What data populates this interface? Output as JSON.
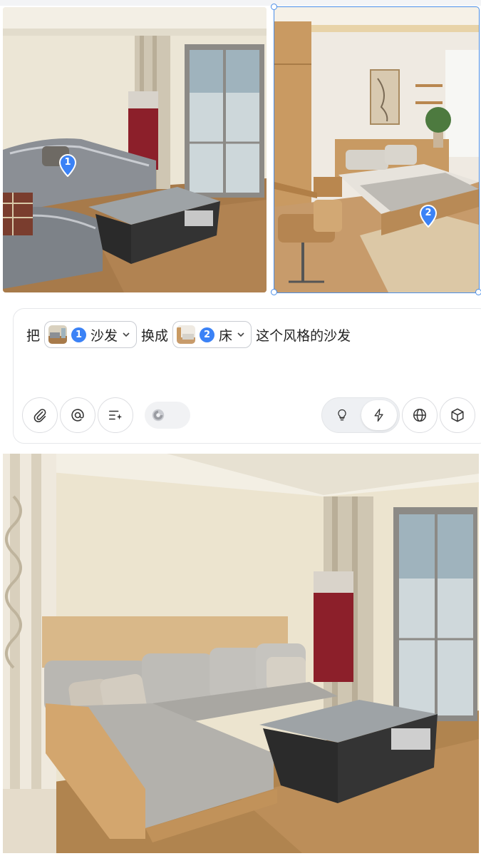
{
  "prompt": {
    "prefix": "把",
    "chip1": {
      "number": "1",
      "label": "沙发"
    },
    "middle": "换成",
    "chip2": {
      "number": "2",
      "label": "床"
    },
    "suffix": "这个风格的沙发"
  },
  "pins": {
    "photo1": "1",
    "photo2": "2"
  },
  "toolbar": {
    "left_icons": [
      "paperclip-icon",
      "at-icon",
      "sparkle-list-icon",
      "model-toggle-icon"
    ],
    "mode_icons": [
      "lightbulb-icon",
      "lightning-icon"
    ],
    "right_icons": [
      "globe-icon",
      "cube-icon"
    ],
    "active_mode": "lightning"
  },
  "colors": {
    "accent": "#3b82f6",
    "selection": "#4a8ee8"
  }
}
